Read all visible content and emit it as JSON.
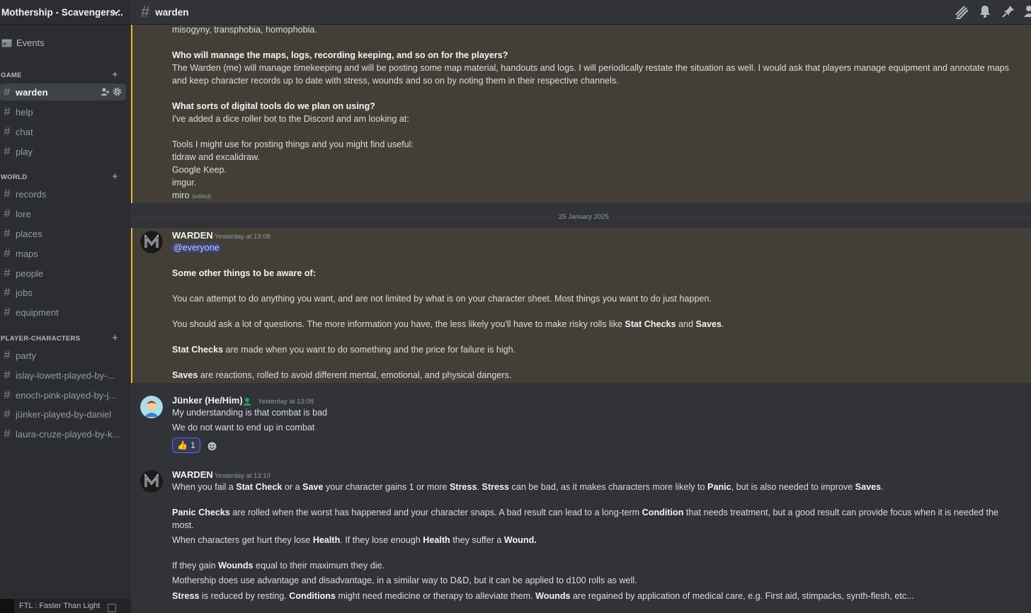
{
  "server": {
    "name": "Mothership - Scavengers..."
  },
  "sidebar": {
    "events_label": "Events",
    "categories": [
      {
        "label": "GAME"
      },
      {
        "label": "WORLD"
      },
      {
        "label": "PLAYER-CHARACTERS"
      }
    ],
    "channels": [
      {
        "label": "warden"
      },
      {
        "label": "help"
      },
      {
        "label": "chat"
      },
      {
        "label": "play"
      },
      {
        "label": "records"
      },
      {
        "label": "lore"
      },
      {
        "label": "places"
      },
      {
        "label": "maps"
      },
      {
        "label": "people"
      },
      {
        "label": "jobs"
      },
      {
        "label": "equipment"
      },
      {
        "label": "party"
      },
      {
        "label": "islay-lowett-played-by-..."
      },
      {
        "label": "enoch-pink-played-by-j..."
      },
      {
        "label": "jünker-played-by-daniel"
      },
      {
        "label": "laura-cruze-played-by-k..."
      }
    ]
  },
  "voice_bar": {
    "label": "FTL : Faster Than Light"
  },
  "topbar": {
    "channel": "warden"
  },
  "icons": {
    "threads": "threads-icon",
    "bell": "bell-icon",
    "pin": "pin-icon",
    "members": "members-icon",
    "add_user": "add-user-icon",
    "gear": "gear-icon",
    "calendar": "calendar-icon",
    "chevron": "chevron-down-icon",
    "emoji": "add-reaction-icon"
  },
  "colors": {
    "highlight_bg": "#433f37",
    "highlight_border": "#f0b232",
    "mention_bg": "#3c4270",
    "reaction_border": "#5865f2"
  },
  "messages": {
    "prev": {
      "l1": "misogyny, transphobia,    homophobia.",
      "q1": "Who will manage the maps, logs, recording keeping, and so on for the players?",
      "a1": "The Warden (me) will manage timekeeping and will be posting some map material, handouts and logs. I will periodically restate the situation as well. I would ask that players manage equipment and annotate maps",
      "a1b": "and keep character records up to date with stress, wounds and so on by noting them in their respective channels.",
      "q2": "What sorts of digital tools do we plan on using?",
      "a2": "I've added a dice roller bot to the Discord and am looking at:",
      "t0": "Tools I might use for posting things and you might find useful:",
      "t1": "tldraw and excalidraw.",
      "t2": "Google Keep.",
      "t3": "imgur.",
      "t4": "miro",
      "edited": "(edited)"
    },
    "date_divider": "25 January 2025",
    "m1": {
      "author": "WARDEN",
      "time": "Yesterday at 13:08",
      "mention": "@everyone",
      "p1": "Some other things to be aware of:",
      "p2": "You can attempt to do anything you want, and are not limited by what is on your character sheet. Most things you want to do just happen.",
      "p3a": "You should ask a lot of questions. The more information you have, the less likely you'll have to make risky rolls like ",
      "p3b": "Stat Checks",
      "p3c": " and ",
      "p3d": "Saves",
      "p3e": ".",
      "p4a": "Stat Checks",
      "p4b": " are made when you want to do something and the price for failure is high.",
      "p5a": "Saves",
      "p5b": " are reactions, rolled to avoid different mental, emotional, and physical dangers."
    },
    "m2": {
      "author": "Jünker (He/Him)",
      "time": "Yesterday at 13:08",
      "l1": "My understanding is that combat is bad",
      "l2": "We do not want to end up in combat",
      "reaction_emoji": "👍",
      "reaction_count": "1"
    },
    "m3": {
      "author": "WARDEN",
      "time": "Yesterday at 13:10",
      "l1": [
        {
          "t": "When you fail a "
        },
        {
          "t": "Stat Check",
          "b": true
        },
        {
          "t": " or a "
        },
        {
          "t": "Save",
          "b": true
        },
        {
          "t": " your character gains 1 or more "
        },
        {
          "t": "Stress",
          "b": true
        },
        {
          "t": ". "
        },
        {
          "t": "Stress",
          "b": true
        },
        {
          "t": " can be bad, as it makes characters more likely to "
        },
        {
          "t": "Panic",
          "b": true
        },
        {
          "t": ", but is also needed to improve "
        },
        {
          "t": "Saves",
          "b": true
        },
        {
          "t": "."
        }
      ],
      "l2": [
        {
          "t": "Panic Checks",
          "b": true
        },
        {
          "t": " are rolled when the worst has happened and your character snaps. A bad result can lead to a long-term "
        },
        {
          "t": "Condition",
          "b": true
        },
        {
          "t": " that needs treatment, but a good result can provide focus when it is needed the"
        }
      ],
      "l2b": [
        {
          "t": "most."
        }
      ],
      "l3": [
        {
          "t": "When characters get hurt they lose "
        },
        {
          "t": "Health",
          "b": true
        },
        {
          "t": ". If they lose enough "
        },
        {
          "t": "Health",
          "b": true
        },
        {
          "t": " they suffer a "
        },
        {
          "t": "Wound.",
          "b": true
        }
      ],
      "l4": [
        {
          "t": "If they gain "
        },
        {
          "t": "Wounds",
          "b": true
        },
        {
          "t": " equal to their maximum they die."
        }
      ],
      "l5": [
        {
          "t": "Mothership does use advantage and disadvantage, in a similar way to D&D, but it can be applied to d100 rolls as well."
        }
      ],
      "l6": [
        {
          "t": "Stress",
          "b": true
        },
        {
          "t": " is reduced by resting. "
        },
        {
          "t": "Conditions",
          "b": true
        },
        {
          "t": " might need medicine or therapy to alleviate them. "
        },
        {
          "t": "Wounds",
          "b": true
        },
        {
          "t": " are regained by application of medical care, e.g. First aid, stimpacks, synth-flesh, etc..."
        }
      ]
    }
  }
}
